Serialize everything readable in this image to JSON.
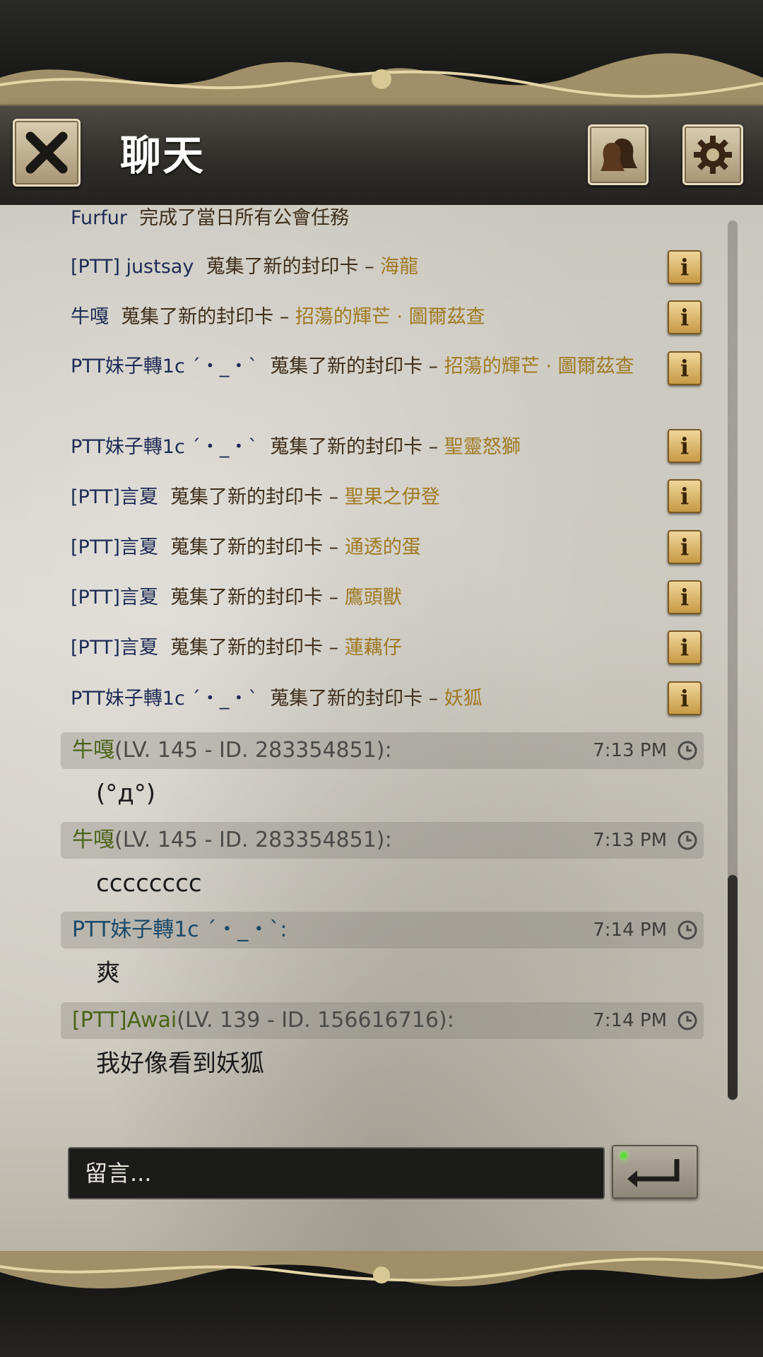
{
  "header": {
    "title": "聊天",
    "close_icon": "close-x-icon",
    "friends_icon": "friends-silhouette-icon",
    "settings_icon": "gear-icon"
  },
  "system_messages": [
    {
      "name": "Furfur",
      "action": "完成了當日所有公會任務",
      "card": "",
      "has_info": false
    },
    {
      "name": "[PTT] justsay",
      "action": "蒐集了新的封印卡 –",
      "card": "海龍",
      "has_info": true
    },
    {
      "name": "牛嘎",
      "action": "蒐集了新的封印卡 –",
      "card": "招蕩的輝芒 · 圖爾茲查",
      "has_info": true
    },
    {
      "name": "PTT妹子轉1c ´・_・`",
      "action": "蒐集了新的封印卡 –",
      "card": "招蕩的輝芒 · 圖爾茲查",
      "has_info": true
    },
    {
      "name": "PTT妹子轉1c ´・_・`",
      "action": "蒐集了新的封印卡 –",
      "card": "聖靈怒獅",
      "has_info": true
    },
    {
      "name": "[PTT]言夏",
      "action": "蒐集了新的封印卡 –",
      "card": "聖果之伊登",
      "has_info": true
    },
    {
      "name": "[PTT]言夏",
      "action": "蒐集了新的封印卡 –",
      "card": "通透的蛋",
      "has_info": true
    },
    {
      "name": "[PTT]言夏",
      "action": "蒐集了新的封印卡 –",
      "card": "鷹頭獸",
      "has_info": true
    },
    {
      "name": "[PTT]言夏",
      "action": "蒐集了新的封印卡 –",
      "card": "蓮藕仔",
      "has_info": true
    },
    {
      "name": "PTT妹子轉1c ´・_・`",
      "action": "蒐集了新的封印卡 –",
      "card": "妖狐",
      "has_info": true
    }
  ],
  "chat_messages": [
    {
      "name": "牛嘎",
      "meta": "(LV. 145 - ID. 283354851):",
      "time": "7:13 PM",
      "text": "(°д°)"
    },
    {
      "name": "牛嘎",
      "meta": "(LV. 145 - ID. 283354851):",
      "time": "7:13 PM",
      "text": "cccccccc"
    },
    {
      "name": "PTT妹子轉1c ´・_・`:",
      "meta": "",
      "time": "7:14 PM",
      "text": "爽"
    },
    {
      "name": "[PTT]Awai",
      "meta": "(LV. 139 - ID. 156616716):",
      "time": "7:14 PM",
      "text": "我好像看到妖狐"
    }
  ],
  "input": {
    "placeholder": "留言..."
  },
  "info_label": "i",
  "colors": {
    "name_blue": "#1d2a55",
    "card_gold": "#a07a22",
    "chat_green": "#4a6318"
  }
}
